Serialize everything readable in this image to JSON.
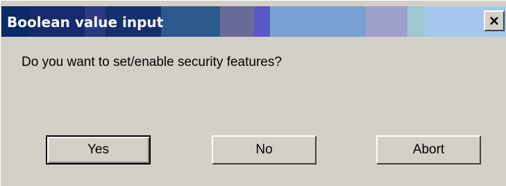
{
  "window": {
    "title": "Boolean value input",
    "titlebar_colors": [
      "#0a2a6a",
      "#123a80",
      "#2a3a7a",
      "#2c5a8e",
      "#6a6a9a",
      "#5858c8",
      "#7aa0d4",
      "#a0a0cc",
      "#9ec8d0",
      "#a6c8ee"
    ],
    "close_glyph": "close-icon"
  },
  "dialog": {
    "message": "Do you want to set/enable security features?"
  },
  "buttons": {
    "yes_label": "Yes",
    "no_label": "No",
    "abort_label": "Abort"
  },
  "colors": {
    "face": "#d4d0c8",
    "text": "#000000",
    "title_text": "#ffffff"
  }
}
